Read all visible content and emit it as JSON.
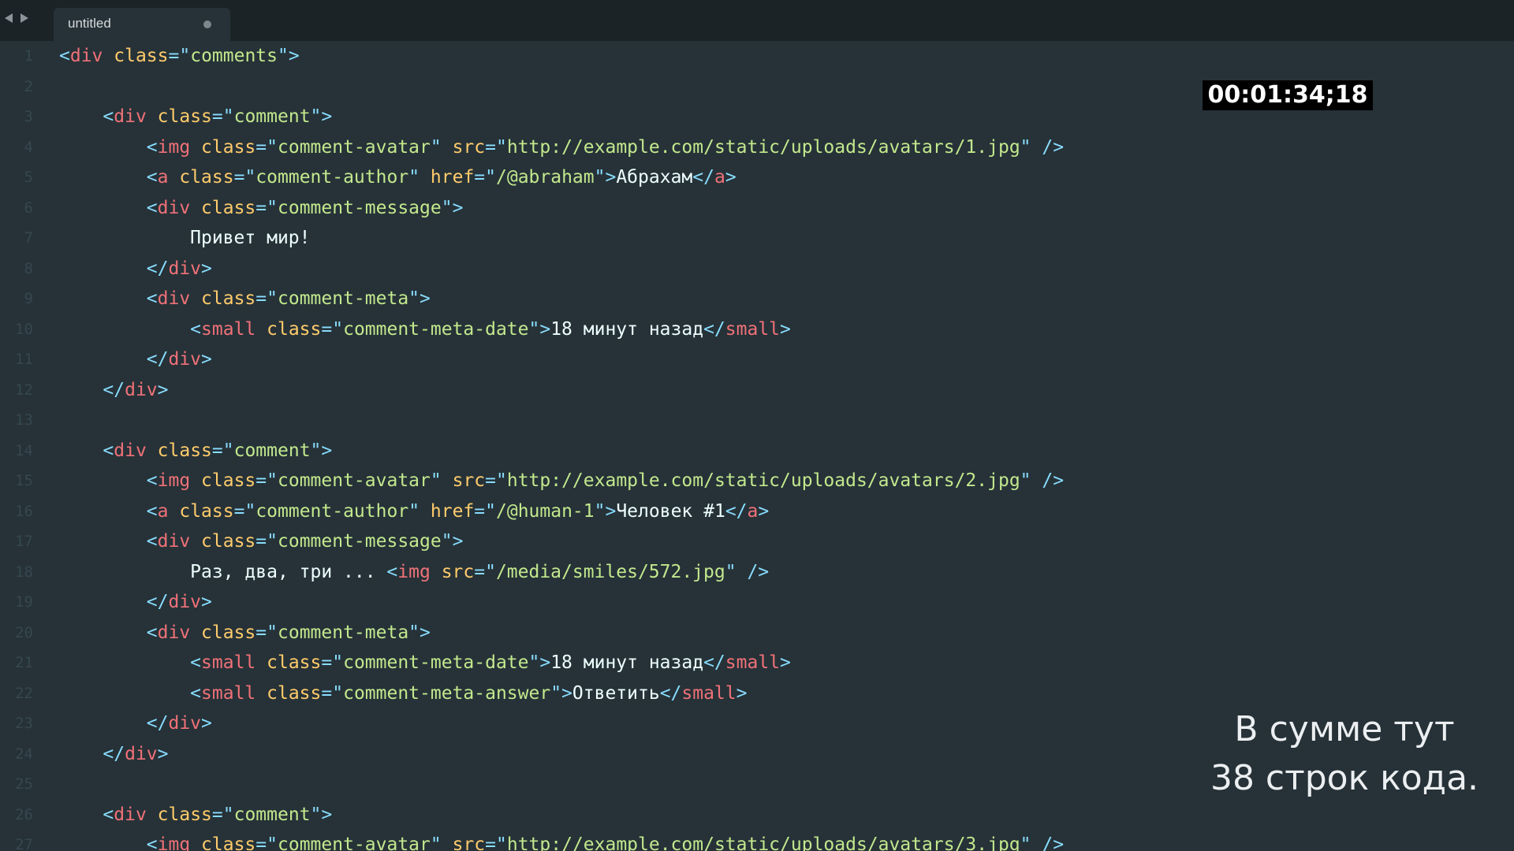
{
  "window": {
    "title": "untitled"
  },
  "nav": {
    "back_icon": "arrow-left-icon",
    "forward_icon": "arrow-right-icon"
  },
  "tab": {
    "label": "untitled",
    "dirty_indicator_icon": "circle-dot-icon"
  },
  "overlay": {
    "timecode": "00:01:34;18",
    "caption_line1": "В сумме тут",
    "caption_line2": "38 строк кода."
  },
  "editor": {
    "line_numbers": [
      "1",
      "2",
      "3",
      "4",
      "5",
      "6",
      "7",
      "8",
      "9",
      "10",
      "11",
      "12",
      "13",
      "14",
      "15",
      "16",
      "17",
      "18",
      "19",
      "20",
      "21",
      "22",
      "23",
      "24",
      "25",
      "26",
      "27"
    ],
    "lines": [
      [
        [
          "p",
          "<"
        ],
        [
          "t",
          "div"
        ],
        [
          "x",
          " "
        ],
        [
          "a",
          "class"
        ],
        [
          "p",
          "=\""
        ],
        [
          "s",
          "comments"
        ],
        [
          "p",
          "\">"
        ]
      ],
      [],
      [
        [
          "x",
          "    "
        ],
        [
          "p",
          "<"
        ],
        [
          "t",
          "div"
        ],
        [
          "x",
          " "
        ],
        [
          "a",
          "class"
        ],
        [
          "p",
          "=\""
        ],
        [
          "s",
          "comment"
        ],
        [
          "p",
          "\">"
        ]
      ],
      [
        [
          "x",
          "        "
        ],
        [
          "p",
          "<"
        ],
        [
          "t",
          "img"
        ],
        [
          "x",
          " "
        ],
        [
          "a",
          "class"
        ],
        [
          "p",
          "=\""
        ],
        [
          "s",
          "comment-avatar"
        ],
        [
          "p",
          "\""
        ],
        [
          "x",
          " "
        ],
        [
          "a",
          "src"
        ],
        [
          "p",
          "=\""
        ],
        [
          "s",
          "http://example.com/static/uploads/avatars/1.jpg"
        ],
        [
          "p",
          "\""
        ],
        [
          "x",
          " "
        ],
        [
          "p",
          "/>"
        ]
      ],
      [
        [
          "x",
          "        "
        ],
        [
          "p",
          "<"
        ],
        [
          "t",
          "a"
        ],
        [
          "x",
          " "
        ],
        [
          "a",
          "class"
        ],
        [
          "p",
          "=\""
        ],
        [
          "s",
          "comment-author"
        ],
        [
          "p",
          "\""
        ],
        [
          "x",
          " "
        ],
        [
          "a",
          "href"
        ],
        [
          "p",
          "=\""
        ],
        [
          "s",
          "/@abraham"
        ],
        [
          "p",
          "\">"
        ],
        [
          "x",
          "Абрахам"
        ],
        [
          "p",
          "</"
        ],
        [
          "t",
          "a"
        ],
        [
          "p",
          ">"
        ]
      ],
      [
        [
          "x",
          "        "
        ],
        [
          "p",
          "<"
        ],
        [
          "t",
          "div"
        ],
        [
          "x",
          " "
        ],
        [
          "a",
          "class"
        ],
        [
          "p",
          "=\""
        ],
        [
          "s",
          "comment-message"
        ],
        [
          "p",
          "\">"
        ]
      ],
      [
        [
          "x",
          "            Привет мир!"
        ]
      ],
      [
        [
          "x",
          "        "
        ],
        [
          "p",
          "</"
        ],
        [
          "t",
          "div"
        ],
        [
          "p",
          ">"
        ]
      ],
      [
        [
          "x",
          "        "
        ],
        [
          "p",
          "<"
        ],
        [
          "t",
          "div"
        ],
        [
          "x",
          " "
        ],
        [
          "a",
          "class"
        ],
        [
          "p",
          "=\""
        ],
        [
          "s",
          "comment-meta"
        ],
        [
          "p",
          "\">"
        ]
      ],
      [
        [
          "x",
          "            "
        ],
        [
          "p",
          "<"
        ],
        [
          "t",
          "small"
        ],
        [
          "x",
          " "
        ],
        [
          "a",
          "class"
        ],
        [
          "p",
          "=\""
        ],
        [
          "s",
          "comment-meta-date"
        ],
        [
          "p",
          "\">"
        ],
        [
          "x",
          "18 минут назад"
        ],
        [
          "p",
          "</"
        ],
        [
          "t",
          "small"
        ],
        [
          "p",
          ">"
        ]
      ],
      [
        [
          "x",
          "        "
        ],
        [
          "p",
          "</"
        ],
        [
          "t",
          "div"
        ],
        [
          "p",
          ">"
        ]
      ],
      [
        [
          "x",
          "    "
        ],
        [
          "p",
          "</"
        ],
        [
          "t",
          "div"
        ],
        [
          "p",
          ">"
        ]
      ],
      [],
      [
        [
          "x",
          "    "
        ],
        [
          "p",
          "<"
        ],
        [
          "t",
          "div"
        ],
        [
          "x",
          " "
        ],
        [
          "a",
          "class"
        ],
        [
          "p",
          "=\""
        ],
        [
          "s",
          "comment"
        ],
        [
          "p",
          "\">"
        ]
      ],
      [
        [
          "x",
          "        "
        ],
        [
          "p",
          "<"
        ],
        [
          "t",
          "img"
        ],
        [
          "x",
          " "
        ],
        [
          "a",
          "class"
        ],
        [
          "p",
          "=\""
        ],
        [
          "s",
          "comment-avatar"
        ],
        [
          "p",
          "\""
        ],
        [
          "x",
          " "
        ],
        [
          "a",
          "src"
        ],
        [
          "p",
          "=\""
        ],
        [
          "s",
          "http://example.com/static/uploads/avatars/2.jpg"
        ],
        [
          "p",
          "\""
        ],
        [
          "x",
          " "
        ],
        [
          "p",
          "/>"
        ]
      ],
      [
        [
          "x",
          "        "
        ],
        [
          "p",
          "<"
        ],
        [
          "t",
          "a"
        ],
        [
          "x",
          " "
        ],
        [
          "a",
          "class"
        ],
        [
          "p",
          "=\""
        ],
        [
          "s",
          "comment-author"
        ],
        [
          "p",
          "\""
        ],
        [
          "x",
          " "
        ],
        [
          "a",
          "href"
        ],
        [
          "p",
          "=\""
        ],
        [
          "s",
          "/@human-1"
        ],
        [
          "p",
          "\">"
        ],
        [
          "x",
          "Человек #1"
        ],
        [
          "p",
          "</"
        ],
        [
          "t",
          "a"
        ],
        [
          "p",
          ">"
        ]
      ],
      [
        [
          "x",
          "        "
        ],
        [
          "p",
          "<"
        ],
        [
          "t",
          "div"
        ],
        [
          "x",
          " "
        ],
        [
          "a",
          "class"
        ],
        [
          "p",
          "=\""
        ],
        [
          "s",
          "comment-message"
        ],
        [
          "p",
          "\">"
        ]
      ],
      [
        [
          "x",
          "            Раз, два, три ... "
        ],
        [
          "p",
          "<"
        ],
        [
          "t",
          "img"
        ],
        [
          "x",
          " "
        ],
        [
          "a",
          "src"
        ],
        [
          "p",
          "=\""
        ],
        [
          "s",
          "/media/smiles/572.jpg"
        ],
        [
          "p",
          "\""
        ],
        [
          "x",
          " "
        ],
        [
          "p",
          "/>"
        ]
      ],
      [
        [
          "x",
          "        "
        ],
        [
          "p",
          "</"
        ],
        [
          "t",
          "div"
        ],
        [
          "p",
          ">"
        ]
      ],
      [
        [
          "x",
          "        "
        ],
        [
          "p",
          "<"
        ],
        [
          "t",
          "div"
        ],
        [
          "x",
          " "
        ],
        [
          "a",
          "class"
        ],
        [
          "p",
          "=\""
        ],
        [
          "s",
          "comment-meta"
        ],
        [
          "p",
          "\">"
        ]
      ],
      [
        [
          "x",
          "            "
        ],
        [
          "p",
          "<"
        ],
        [
          "t",
          "small"
        ],
        [
          "x",
          " "
        ],
        [
          "a",
          "class"
        ],
        [
          "p",
          "=\""
        ],
        [
          "s",
          "comment-meta-date"
        ],
        [
          "p",
          "\">"
        ],
        [
          "x",
          "18 минут назад"
        ],
        [
          "p",
          "</"
        ],
        [
          "t",
          "small"
        ],
        [
          "p",
          ">"
        ]
      ],
      [
        [
          "x",
          "            "
        ],
        [
          "p",
          "<"
        ],
        [
          "t",
          "small"
        ],
        [
          "x",
          " "
        ],
        [
          "a",
          "class"
        ],
        [
          "p",
          "=\""
        ],
        [
          "s",
          "comment-meta-answer"
        ],
        [
          "p",
          "\">"
        ],
        [
          "x",
          "Ответить"
        ],
        [
          "p",
          "</"
        ],
        [
          "t",
          "small"
        ],
        [
          "p",
          ">"
        ]
      ],
      [
        [
          "x",
          "        "
        ],
        [
          "p",
          "</"
        ],
        [
          "t",
          "div"
        ],
        [
          "p",
          ">"
        ]
      ],
      [
        [
          "x",
          "    "
        ],
        [
          "p",
          "</"
        ],
        [
          "t",
          "div"
        ],
        [
          "p",
          ">"
        ]
      ],
      [],
      [
        [
          "x",
          "    "
        ],
        [
          "p",
          "<"
        ],
        [
          "t",
          "div"
        ],
        [
          "x",
          " "
        ],
        [
          "a",
          "class"
        ],
        [
          "p",
          "=\""
        ],
        [
          "s",
          "comment"
        ],
        [
          "p",
          "\">"
        ]
      ],
      [
        [
          "x",
          "        "
        ],
        [
          "p",
          "<"
        ],
        [
          "t",
          "img"
        ],
        [
          "x",
          " "
        ],
        [
          "a",
          "class"
        ],
        [
          "p",
          "=\""
        ],
        [
          "s",
          "comment-avatar"
        ],
        [
          "p",
          "\""
        ],
        [
          "x",
          " "
        ],
        [
          "a",
          "src"
        ],
        [
          "p",
          "=\""
        ],
        [
          "s",
          "http://example.com/static/uploads/avatars/3.jpg"
        ],
        [
          "p",
          "\""
        ],
        [
          "x",
          " "
        ],
        [
          "p",
          "/>"
        ]
      ]
    ]
  }
}
